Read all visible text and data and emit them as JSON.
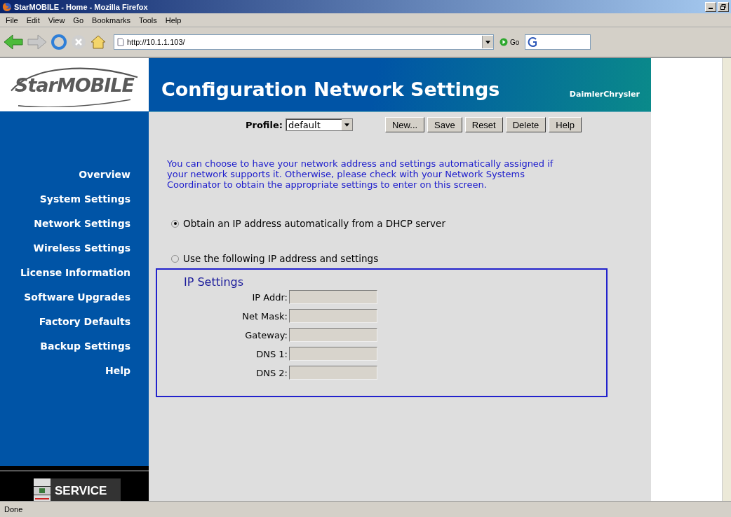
{
  "window": {
    "title": "StarMOBILE - Home - Mozilla Firefox"
  },
  "menu": [
    "File",
    "Edit",
    "View",
    "Go",
    "Bookmarks",
    "Tools",
    "Help"
  ],
  "address_bar": {
    "value": "http://10.1.1.103/",
    "go_label": "Go"
  },
  "logo": {
    "text": "StarMOBILE"
  },
  "banner": {
    "title": "Configuration Network Settings",
    "brand": "DaimlerChrysler"
  },
  "sidebar": {
    "items": [
      {
        "label": "Overview"
      },
      {
        "label": "System Settings"
      },
      {
        "label": "Network Settings"
      },
      {
        "label": "Wireless Settings"
      },
      {
        "label": "License Information"
      },
      {
        "label": "Software Upgrades"
      },
      {
        "label": "Factory Defaults"
      },
      {
        "label": "Backup Settings"
      },
      {
        "label": "Help"
      }
    ],
    "service_label": "SERVICE"
  },
  "profile": {
    "label": "Profile:",
    "value": "default"
  },
  "buttons": [
    "New...",
    "Save",
    "Reset",
    "Delete",
    "Help"
  ],
  "intro": "You can choose to have your network address and settings automatically assigned if your network supports it.  Otherwise, please check with your Network Systems Coordinator to obtain the appropriate settings to enter on this screen.",
  "options": [
    {
      "label": "Obtain an IP address automatically from a DHCP server",
      "selected": true
    },
    {
      "label": "Use the following IP address and settings",
      "selected": false
    }
  ],
  "ip_settings": {
    "title": "IP Settings",
    "fields": [
      {
        "label": "IP Addr:",
        "disabled": true
      },
      {
        "label": "Net Mask:",
        "disabled": true
      },
      {
        "label": "Gateway:",
        "disabled": true
      },
      {
        "label": "DNS 1:",
        "disabled": true
      },
      {
        "label": "DNS 2:",
        "disabled": true
      }
    ]
  },
  "status_bar": {
    "text": "Done"
  }
}
